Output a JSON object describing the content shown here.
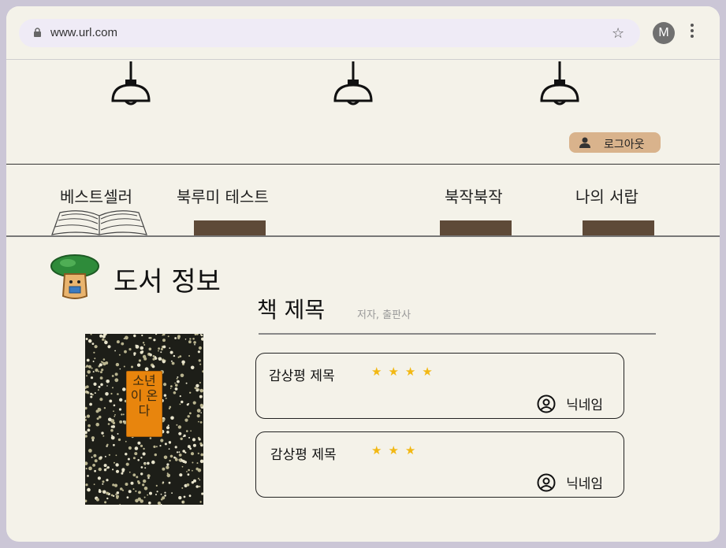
{
  "browser": {
    "url": "www.url.com",
    "profile_initial": "M"
  },
  "header": {
    "logout_label": "로그아웃"
  },
  "nav": {
    "items": [
      {
        "label": "베스트셀러"
      },
      {
        "label": "북루미 테스트"
      },
      {
        "label": "북작북작"
      },
      {
        "label": "나의 서랍"
      }
    ]
  },
  "section": {
    "title": "도서 정보"
  },
  "book": {
    "title": "책 제목",
    "author_publisher": "저자, 출판사",
    "cover_title": "소년이 온다"
  },
  "reviews": [
    {
      "title": "감상평 제목",
      "rating": 4,
      "stars": "★★★★",
      "nickname": "닉네임"
    },
    {
      "title": "감상평 제목",
      "rating": 3,
      "stars": "★★★",
      "nickname": "닉네임"
    }
  ],
  "colors": {
    "background": "#f4f2e9",
    "logout_bg": "#d9b38c",
    "nav_bar": "#5e4a38",
    "star": "#f2b813",
    "cover_label": "#e8850d"
  }
}
